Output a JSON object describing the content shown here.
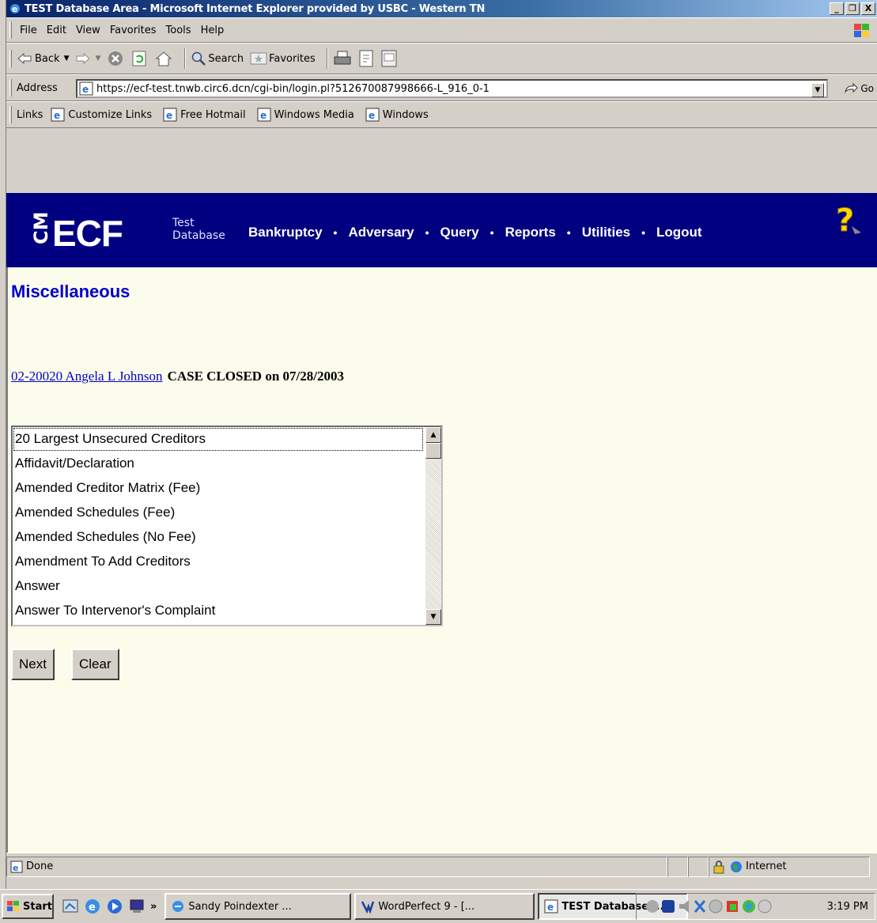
{
  "window": {
    "title": "TEST Database Area - Microsoft Internet Explorer provided by USBC - Western TN",
    "min_label": "_",
    "max_label": "❐",
    "close_label": "X"
  },
  "menu": [
    "File",
    "Edit",
    "View",
    "Favorites",
    "Tools",
    "Help"
  ],
  "toolbar": {
    "back_label": "Back",
    "search_label": "Search",
    "favorites_label": "Favorites"
  },
  "address": {
    "label": "Address",
    "url": "https://ecf-test.tnwb.circ6.dcn/cgi-bin/login.pl?512670087998666-L_916_0-1",
    "go_label": "Go"
  },
  "links": {
    "label": "Links",
    "items": [
      "Customize Links",
      "Free Hotmail",
      "Windows Media",
      "Windows"
    ]
  },
  "ecf": {
    "logo_cm": "CM",
    "logo_ecf": "ECF",
    "test_line1": "Test",
    "test_line2": "Database",
    "nav": [
      "Bankruptcy",
      "Adversary",
      "Query",
      "Reports",
      "Utilities",
      "Logout"
    ],
    "nav_separator": "•"
  },
  "page": {
    "title": "Miscellaneous",
    "case_link": "02-20020 Angela L Johnson",
    "case_status": "CASE CLOSED on 07/28/2003",
    "event_options": [
      "20 Largest Unsecured Creditors",
      "Affidavit/Declaration",
      "Amended Creditor Matrix (Fee)",
      "Amended Schedules (Fee)",
      "Amended Schedules (No Fee)",
      "Amendment To Add Creditors",
      "Answer",
      "Answer To Intervenor's Complaint"
    ],
    "next_label": "Next",
    "clear_label": "Clear"
  },
  "status": {
    "text": "Done",
    "zone": "Internet"
  },
  "taskbar": {
    "start_label": "Start",
    "chevron": "»",
    "tasks": [
      "Sandy Poindexter ...",
      "WordPerfect 9 - [...",
      "TEST Database ..."
    ],
    "clock": "3:19 PM"
  },
  "colors": {
    "nav_bg": "#000080",
    "page_bg": "#fcfcec",
    "title_blue": "#0000cc"
  }
}
